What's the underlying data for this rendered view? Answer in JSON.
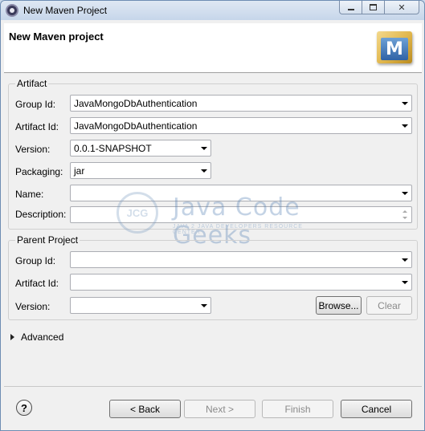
{
  "window": {
    "title": "New Maven Project",
    "icon": "eclipse-icon"
  },
  "banner": {
    "title": "New Maven project",
    "logo_letter": "M",
    "logo_icon": "maven-logo-icon"
  },
  "artifact": {
    "group_label": "Artifact",
    "group_id_label": "Group Id:",
    "group_id_value": "JavaMongoDbAuthentication",
    "artifact_id_label": "Artifact Id:",
    "artifact_id_value": "JavaMongoDbAuthentication",
    "version_label": "Version:",
    "version_value": "0.0.1-SNAPSHOT",
    "packaging_label": "Packaging:",
    "packaging_value": "jar",
    "name_label": "Name:",
    "name_value": "",
    "description_label": "Description:",
    "description_value": ""
  },
  "parent": {
    "group_label": "Parent Project",
    "group_id_label": "Group Id:",
    "group_id_value": "",
    "artifact_id_label": "Artifact Id:",
    "artifact_id_value": "",
    "version_label": "Version:",
    "version_value": "",
    "browse_label": "Browse...",
    "clear_label": "Clear"
  },
  "advanced": {
    "label": "Advanced"
  },
  "footer": {
    "help_glyph": "?",
    "back_label": "< Back",
    "next_label": "Next >",
    "finish_label": "Finish",
    "cancel_label": "Cancel"
  },
  "watermark": {
    "circle_text": "JCG",
    "title": "Java Code Geeks",
    "subtitle": "JAVA 2 JAVA DEVELOPERS RESOURCE CENTER"
  },
  "colors": {
    "title_bar": "#c6d6ea",
    "dialog_bg": "#f0f0f0",
    "disabled_text": "#8a8a8a"
  }
}
